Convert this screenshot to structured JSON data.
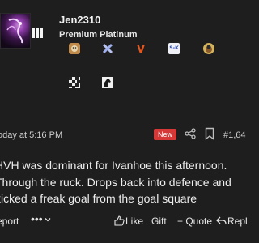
{
  "user": {
    "name": "Jen2310",
    "title": "Premium Platinum"
  },
  "badges": [
    {
      "icon": "dog-badge-icon"
    },
    {
      "icon": "crossed-clubs-badge-icon"
    },
    {
      "icon": "v-logo-badge-icon",
      "text": "V",
      "color": "#e2571e"
    },
    {
      "icon": "team-logo-badge-icon",
      "text": "S-K"
    },
    {
      "icon": "mascot-badge-icon"
    },
    {
      "icon": "checkered-badge-icon"
    },
    {
      "icon": "horse-badge-icon"
    }
  ],
  "post": {
    "timestamp": "oday at 5:16 PM",
    "new_label": "New",
    "number": "#1,64",
    "lines": [
      "HVH was dominant for Ivanhoe this afternoon.",
      "Through the ruck. Drops back into defence and",
      "kicked a freak goal from the goal square"
    ]
  },
  "footer": {
    "report": "eport",
    "more": "•••",
    "like": "Like",
    "gift": "Gift",
    "quote": "+ Quote",
    "reply": "Repl"
  },
  "colors": {
    "background": "#1e1e1f",
    "new_badge": "#d63838"
  }
}
